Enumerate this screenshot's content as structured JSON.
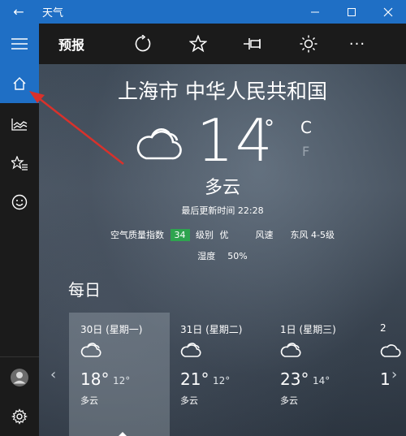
{
  "titlebar": {
    "back_glyph": "←",
    "app_title": "天气",
    "minimize_glyph": "—",
    "maximize_glyph": "☐",
    "close_glyph": "✕"
  },
  "sidebar": {
    "items": [
      {
        "name": "hamburger-menu",
        "icon": "hamburger-icon"
      },
      {
        "name": "home",
        "icon": "home-icon",
        "active": true
      },
      {
        "name": "historical-weather",
        "icon": "chart-icon"
      },
      {
        "name": "favorites",
        "icon": "star-list-icon"
      },
      {
        "name": "feedback",
        "icon": "smiley-icon"
      },
      {
        "name": "account",
        "icon": "user-icon"
      },
      {
        "name": "settings",
        "icon": "gear-icon"
      }
    ]
  },
  "toolbar": {
    "title": "预报",
    "more_glyph": "···",
    "buttons": [
      "refresh-icon",
      "star-icon",
      "pin-icon",
      "sun-icon",
      "more-icon"
    ]
  },
  "current": {
    "location": "上海市 中华人民共和国",
    "temperature": "14",
    "degree_symbol": "°",
    "unit_c": "C",
    "unit_f": "F",
    "condition": "多云",
    "updated": "最后更新时间 22:28",
    "aqi_label": "空气质量指数",
    "aqi_value": "34",
    "level_label": "级别",
    "level_value": "优",
    "wind_label": "风速",
    "wind_value": "东风 4-5级",
    "humidity_label": "湿度",
    "humidity_value": "50%"
  },
  "daily": {
    "title": "每日",
    "prev_glyph": "‹",
    "next_glyph": "›",
    "days": [
      {
        "date": "30日 (星期一)",
        "hi": "18°",
        "lo": "12°",
        "cond": "多云",
        "icon": "cloud-icon",
        "selected": true
      },
      {
        "date": "31日 (星期二)",
        "hi": "21°",
        "lo": "12°",
        "cond": "多云",
        "icon": "cloud-icon"
      },
      {
        "date": "1日 (星期三)",
        "hi": "23°",
        "lo": "14°",
        "cond": "多云",
        "icon": "cloud-icon"
      },
      {
        "date": "2",
        "hi": "1",
        "lo": "",
        "cond": "",
        "icon": "cloud-icon"
      }
    ]
  },
  "colors": {
    "accent": "#1f6fc5",
    "sidebar_bg": "#1b1b1b",
    "aqi_green": "#2ea44f",
    "annotation_red": "#d9312b"
  }
}
